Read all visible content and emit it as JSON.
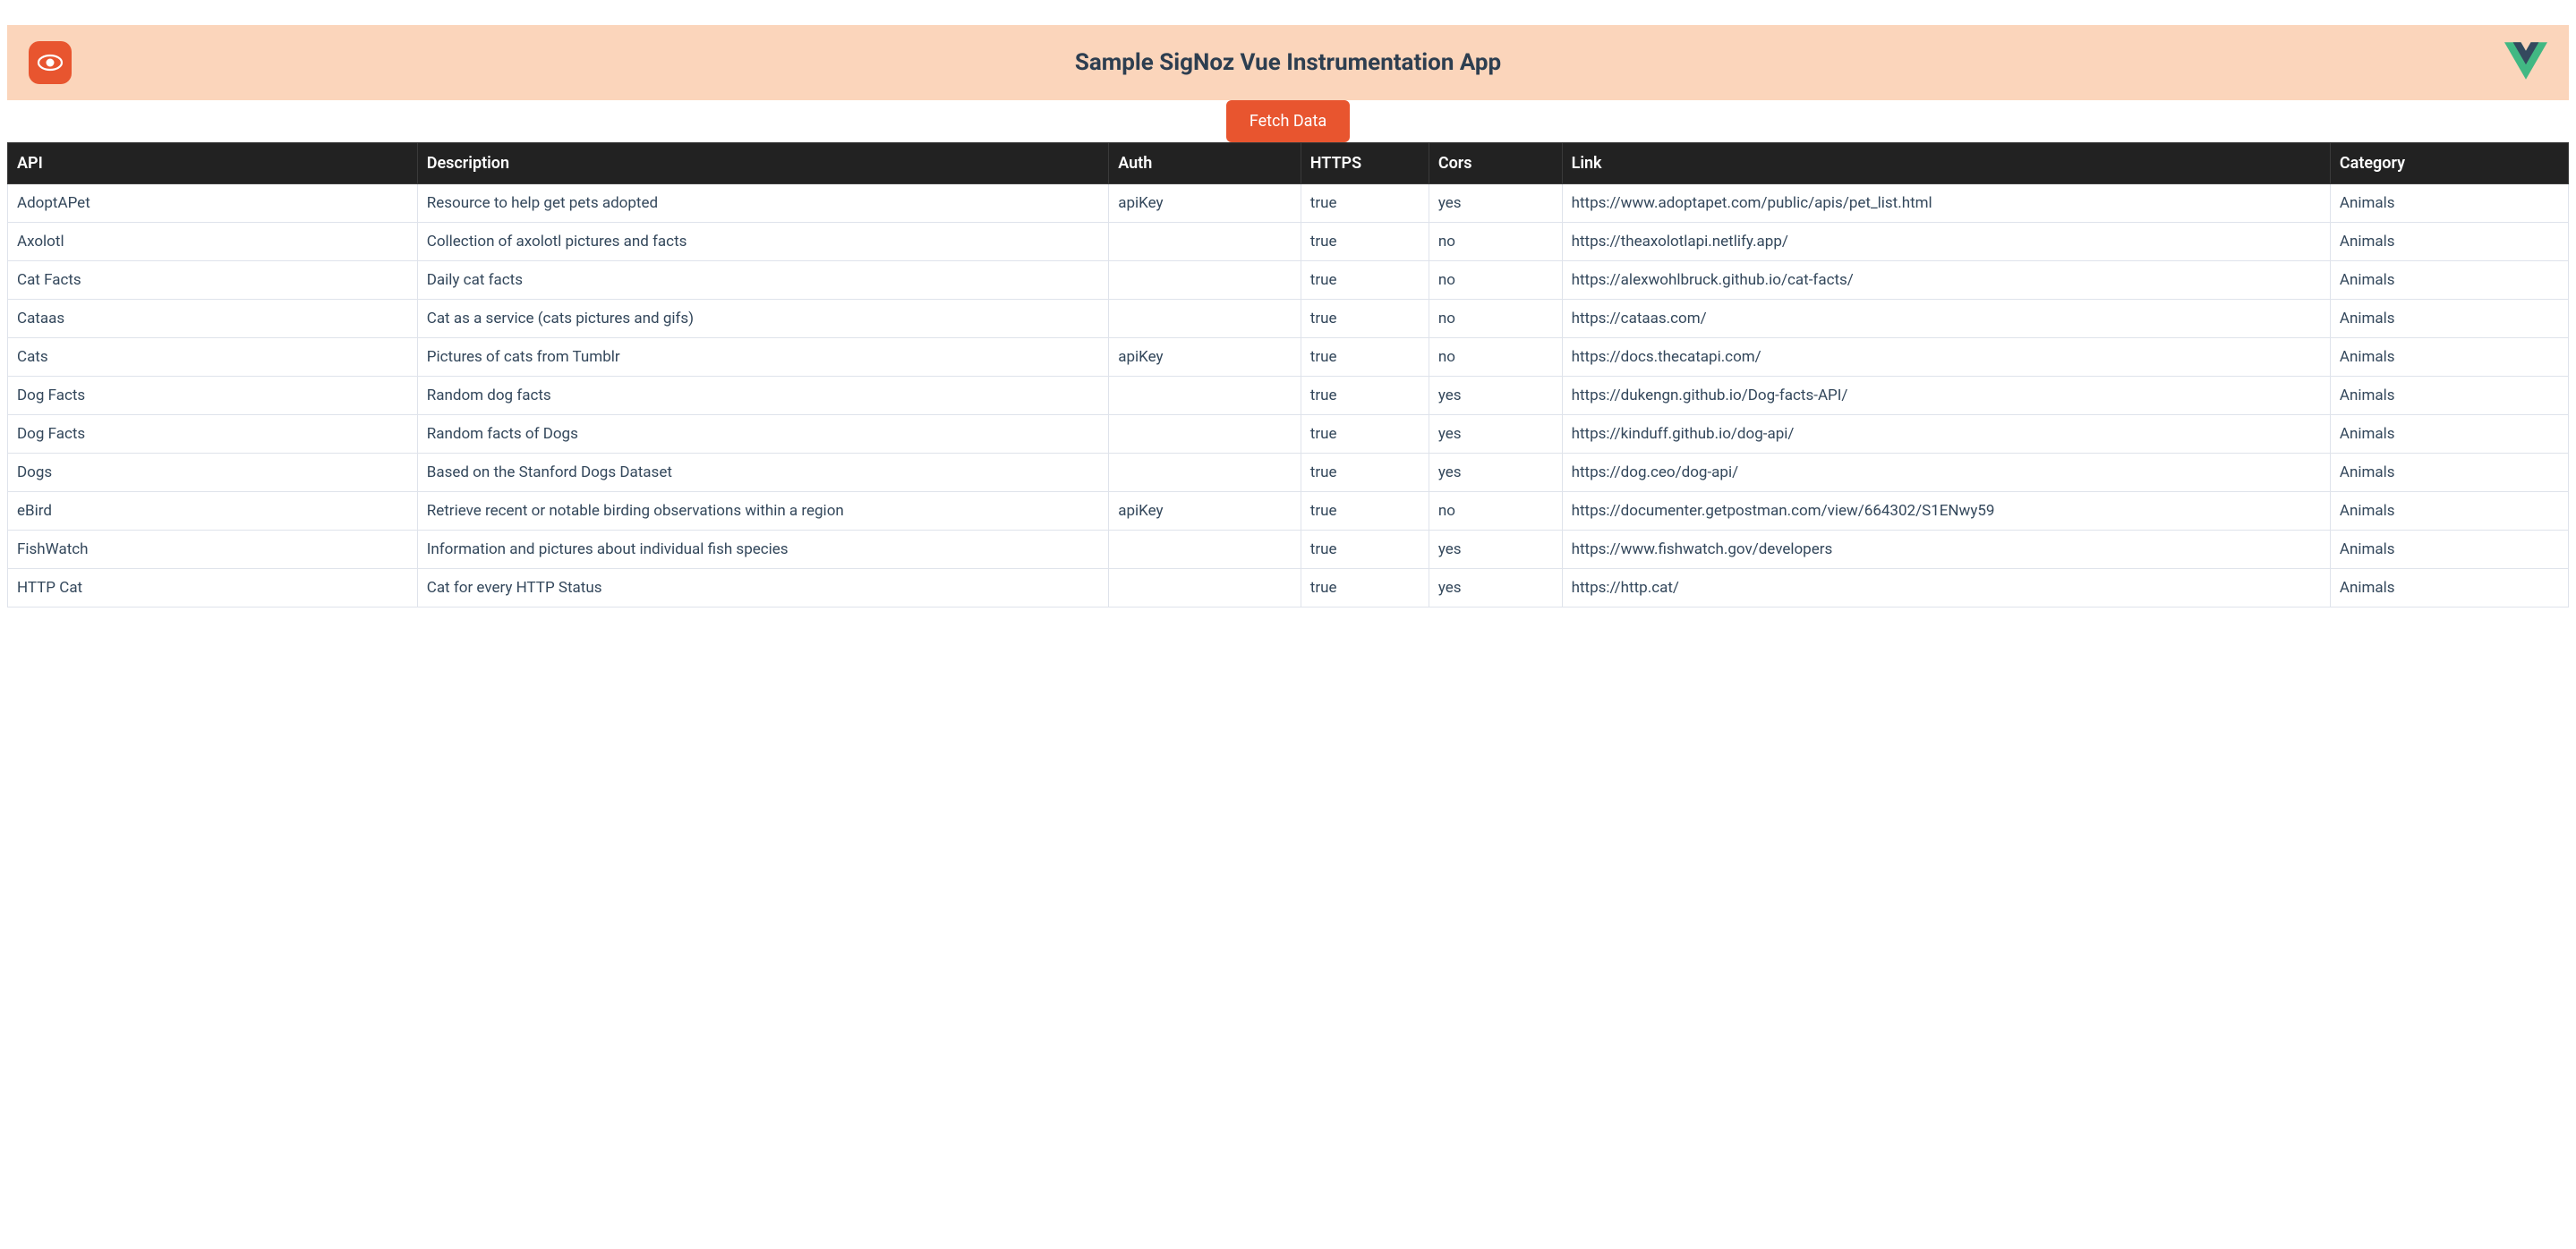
{
  "header": {
    "title": "Sample SigNoz Vue Instrumentation App"
  },
  "actions": {
    "fetch_label": "Fetch Data"
  },
  "table": {
    "headers": {
      "api": "API",
      "description": "Description",
      "auth": "Auth",
      "https": "HTTPS",
      "cors": "Cors",
      "link": "Link",
      "category": "Category"
    },
    "rows": [
      {
        "api": "AdoptAPet",
        "description": "Resource to help get pets adopted",
        "auth": "apiKey",
        "https": "true",
        "cors": "yes",
        "link": "https://www.adoptapet.com/public/apis/pet_list.html",
        "category": "Animals"
      },
      {
        "api": "Axolotl",
        "description": "Collection of axolotl pictures and facts",
        "auth": "",
        "https": "true",
        "cors": "no",
        "link": "https://theaxolotlapi.netlify.app/",
        "category": "Animals"
      },
      {
        "api": "Cat Facts",
        "description": "Daily cat facts",
        "auth": "",
        "https": "true",
        "cors": "no",
        "link": "https://alexwohlbruck.github.io/cat-facts/",
        "category": "Animals"
      },
      {
        "api": "Cataas",
        "description": "Cat as a service (cats pictures and gifs)",
        "auth": "",
        "https": "true",
        "cors": "no",
        "link": "https://cataas.com/",
        "category": "Animals"
      },
      {
        "api": "Cats",
        "description": "Pictures of cats from Tumblr",
        "auth": "apiKey",
        "https": "true",
        "cors": "no",
        "link": "https://docs.thecatapi.com/",
        "category": "Animals"
      },
      {
        "api": "Dog Facts",
        "description": "Random dog facts",
        "auth": "",
        "https": "true",
        "cors": "yes",
        "link": "https://dukengn.github.io/Dog-facts-API/",
        "category": "Animals"
      },
      {
        "api": "Dog Facts",
        "description": "Random facts of Dogs",
        "auth": "",
        "https": "true",
        "cors": "yes",
        "link": "https://kinduff.github.io/dog-api/",
        "category": "Animals"
      },
      {
        "api": "Dogs",
        "description": "Based on the Stanford Dogs Dataset",
        "auth": "",
        "https": "true",
        "cors": "yes",
        "link": "https://dog.ceo/dog-api/",
        "category": "Animals"
      },
      {
        "api": "eBird",
        "description": "Retrieve recent or notable birding observations within a region",
        "auth": "apiKey",
        "https": "true",
        "cors": "no",
        "link": "https://documenter.getpostman.com/view/664302/S1ENwy59",
        "category": "Animals"
      },
      {
        "api": "FishWatch",
        "description": "Information and pictures about individual fish species",
        "auth": "",
        "https": "true",
        "cors": "yes",
        "link": "https://www.fishwatch.gov/developers",
        "category": "Animals"
      },
      {
        "api": "HTTP Cat",
        "description": "Cat for every HTTP Status",
        "auth": "",
        "https": "true",
        "cors": "yes",
        "link": "https://http.cat/",
        "category": "Animals"
      }
    ]
  }
}
